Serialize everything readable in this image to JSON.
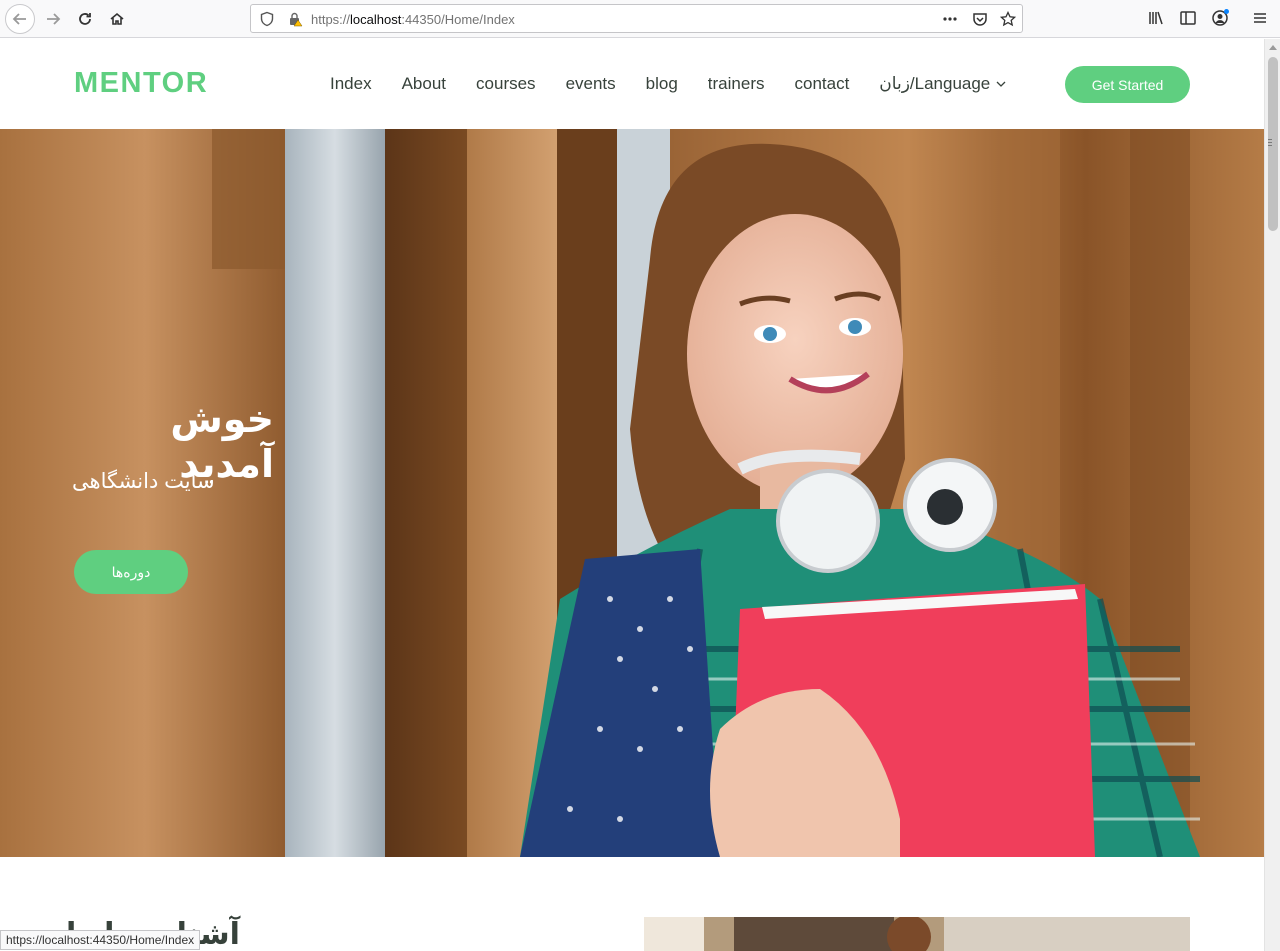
{
  "browser": {
    "url_prefix": "https://",
    "url_host": "localhost",
    "url_rest": ":44350/Home/Index",
    "status_url": "https://localhost:44350/Home/Index"
  },
  "header": {
    "logo": "MENTOR",
    "nav": [
      "Index",
      "About",
      "courses",
      "events",
      "blog",
      "trainers",
      "contact"
    ],
    "language": "زبان/Language",
    "cta": "Get Started"
  },
  "hero": {
    "title": "خوش آمدید",
    "subtitle": "سایت دانشگاهی",
    "button": "دوره‌ها"
  },
  "about": {
    "heading": "آشنایی با ما"
  },
  "colors": {
    "accent": "#5fcf80",
    "text": "#37423b"
  }
}
